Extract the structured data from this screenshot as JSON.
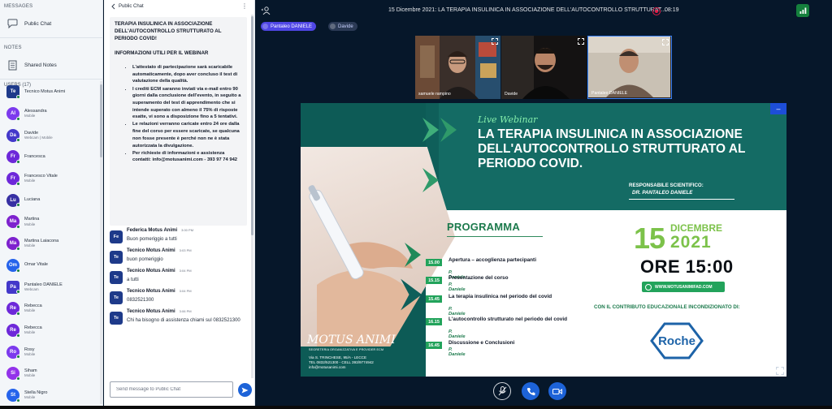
{
  "nav": {
    "messages_header": "MESSAGES",
    "public_chat": "Public Chat",
    "notes_header": "NOTES",
    "shared_notes": "Shared Notes",
    "users_header": "USERS (17)"
  },
  "users": [
    {
      "initials": "Te",
      "name": "Tecnico Motus Animi",
      "status": "",
      "color": "#1e3a8a",
      "square": true
    },
    {
      "initials": "Al",
      "name": "Alessandra",
      "status": "Mobile",
      "color": "#7c3aed",
      "square": false
    },
    {
      "initials": "Da",
      "name": "Davide",
      "status": "Webcam | Mobile",
      "color": "#4338ca",
      "square": false
    },
    {
      "initials": "Fr",
      "name": "Francesca",
      "status": "",
      "color": "#6d28d9",
      "square": false
    },
    {
      "initials": "Fr",
      "name": "Francesco Vitale",
      "status": "Mobile",
      "color": "#6d28d9",
      "square": false
    },
    {
      "initials": "Lu",
      "name": "Luciana",
      "status": "",
      "color": "#3730a3",
      "square": false
    },
    {
      "initials": "Ma",
      "name": "Martina",
      "status": "Mobile",
      "color": "#7e22ce",
      "square": false
    },
    {
      "initials": "Ma",
      "name": "Martina Laiacona",
      "status": "Mobile",
      "color": "#7e22ce",
      "square": false
    },
    {
      "initials": "Om",
      "name": "Omar Vitale",
      "status": "",
      "color": "#2563eb",
      "square": false
    },
    {
      "initials": "Pa",
      "name": "Pantaleo DANIELE",
      "status": "Webcam",
      "color": "#4338ca",
      "square": true
    },
    {
      "initials": "Re",
      "name": "Rebecca",
      "status": "Mobile",
      "color": "#6d28d9",
      "square": false
    },
    {
      "initials": "Re",
      "name": "Rebecca",
      "status": "Mobile",
      "color": "#6d28d9",
      "square": false
    },
    {
      "initials": "Ro",
      "name": "Rosy",
      "status": "Mobile",
      "color": "#7c3aed",
      "square": false
    },
    {
      "initials": "Si",
      "name": "Siham",
      "status": "Mobile",
      "color": "#9333ea",
      "square": false
    },
    {
      "initials": "St",
      "name": "Stella Nigro",
      "status": "Mobile",
      "color": "#2563eb",
      "square": false
    }
  ],
  "chat": {
    "header": "Public Chat",
    "welcome_title": "TERAPIA INSULINICA IN ASSOCIAZIONE DELL'AUTOCONTROLLO STRUTTURATO AL PERIODO COVID!",
    "info_header": "INFORMAZIONI UTILI PER IL WEBINAR",
    "bullets": [
      "L'attestato di partecipazione sarà scaricabile automaticamente, dopo aver concluso il test di valutazione della qualità.",
      "I crediti ECM saranno inviati via e-mail entro 90 giorni dalla conclusione dell'evento, in seguito a superamento del test di apprendimento che si intende superato con almeno il 75% di risposte esatte, vi sono a disposizione fino a 5 tentativi.",
      "Le relazioni verranno caricate entro 24 ore dalla fine del corso per essere scaricate, se qualcuna non fosse presente è perché non ne è stata autorizzata la divulgazione.",
      "Per richieste di informazioni e assistenza contatti: info@motusanimi.com - 393 97 74 942"
    ],
    "messages": [
      {
        "avatar": "Fe",
        "sender": "Federica Motus Animi",
        "time": "3:00 PM",
        "text": "Buon pomeriggio a tutti"
      },
      {
        "avatar": "Te",
        "sender": "Tecnico Motus Animi",
        "time": "3:03 PM",
        "text": "buon pomeriggio"
      },
      {
        "avatar": "Te",
        "sender": "Tecnico Motus Animi",
        "time": "3:04 PM",
        "text": "a tutti"
      },
      {
        "avatar": "Te",
        "sender": "Tecnico Motus Animi",
        "time": "3:04 PM",
        "text": "0832521300"
      },
      {
        "avatar": "Te",
        "sender": "Tecnico Motus Animi",
        "time": "3:06 PM",
        "text": "Chi ha bisogno di assistenza chiami sul 0832521300"
      }
    ],
    "input_placeholder": "Send message to Public Chat"
  },
  "meeting": {
    "title": "15 Dicembre 2021: LA TERAPIA INSULINICA IN ASSOCIAZIONE DELL'AUTOCONTROLLO STRUTTURAT...",
    "recording_time": "08:19",
    "talkers": [
      "Pantaleo DANIELE",
      "Davide"
    ],
    "videos": [
      {
        "name": "samuele rampino"
      },
      {
        "name": "Davide"
      },
      {
        "name": "Pantaleo DANIELE"
      }
    ]
  },
  "slide": {
    "live": "Live Webinar",
    "title": "LA TERAPIA INSULINICA IN ASSOCIAZIONE DELL'AUTOCONTROLLO STRUTTURATO AL PERIODO COVID.",
    "resp_label": "RESPONSABILE SCIENTIFICO:",
    "resp_name": "DR. PANTALEO DANIELE",
    "programma": "PROGRAMMA",
    "agenda": [
      {
        "time": "15.00",
        "title": "Apertura – accoglienza partecipanti",
        "person": "P. Daniele"
      },
      {
        "time": "15.15",
        "title": "Presentazione del corso",
        "person": "P. Daniele"
      },
      {
        "time": "15.45",
        "title": "La terapia insulinica nel periodo del covid",
        "person": "P. Daniele"
      },
      {
        "time": "16.15",
        "title": "L'autocontrollo strutturato nel periodo del covid",
        "person": "P. Daniele"
      },
      {
        "time": "16.45",
        "title": "Discussione e Conclusioni",
        "person": "P. Daniele"
      }
    ],
    "date_day": "15",
    "date_month": "DICEMBRE",
    "date_year": "2021",
    "date_time": "ORE 15:00",
    "website": "WWW.MOTUSANIMIFAD.COM",
    "sponsor": "CON IL CONTRIBUTO EDUCAZIONALE INCONDIZIONATO DI:",
    "sponsor_logo": "Roche",
    "org_logo": "MOTUS ANIMI",
    "org_sub": "SEGRETERIA ORGANIZZATIVA E PROVIDER ECM",
    "org_addr1": "Via S. TRINCHESE, 95/A - LECCE",
    "org_addr2": "TEL 0832/521300 - CELL 393/9774942",
    "org_addr3": "info@motusanimi.com"
  },
  "colors": {
    "accent": "#1d63d8",
    "slide_green": "#0d5b56",
    "recording": "#e11d48"
  }
}
